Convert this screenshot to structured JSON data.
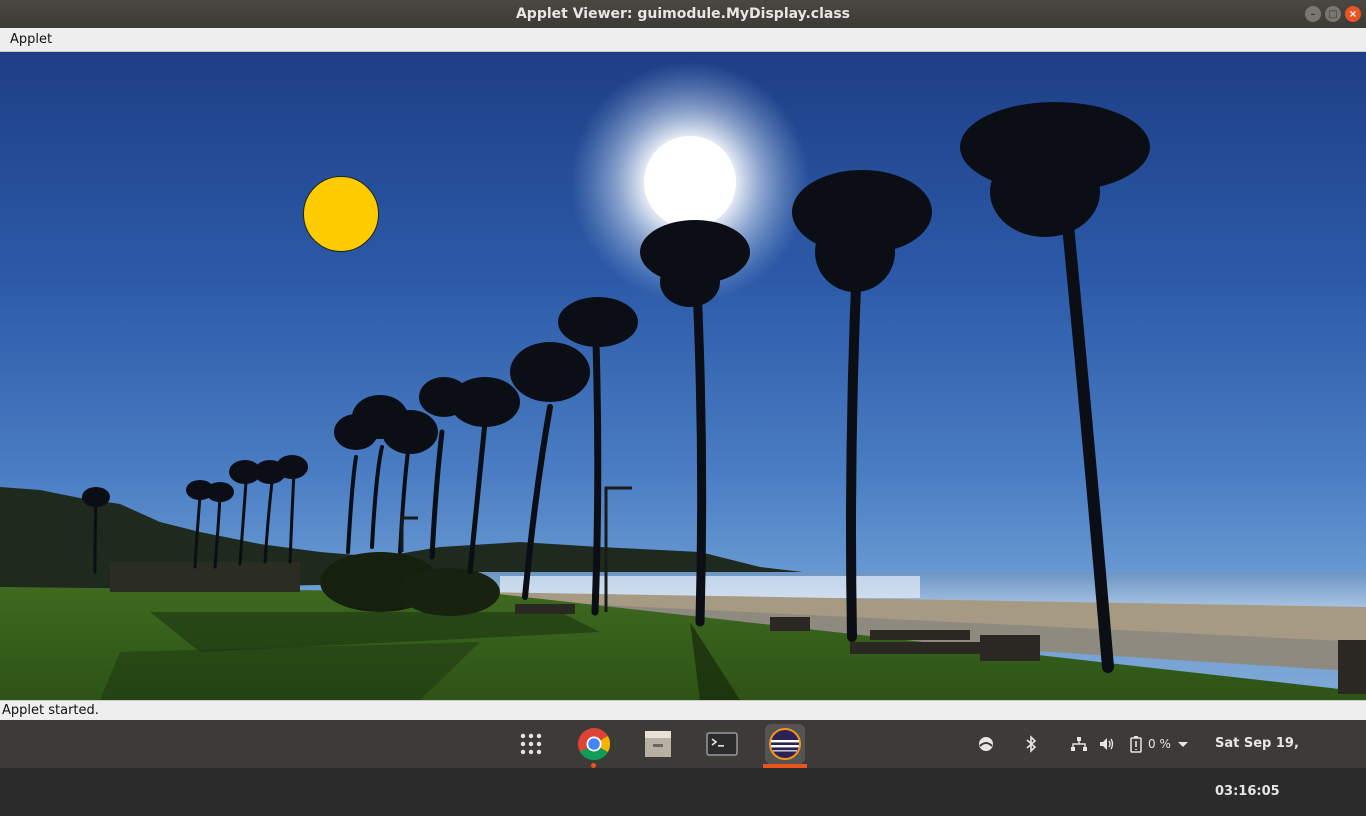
{
  "window": {
    "title": "Applet Viewer: guimodule.MyDisplay.class",
    "controls": {
      "minimize": "–",
      "maximize": "□",
      "close": "×"
    }
  },
  "menubar": {
    "items": [
      {
        "label": "Applet"
      }
    ]
  },
  "applet": {
    "background_image": "beach-palm-trees-photo",
    "shape": {
      "type": "circle",
      "fill": "#ffcc00",
      "stroke": "#222222"
    }
  },
  "statusbar": {
    "text": "Applet started."
  },
  "taskbar": {
    "launchers": [
      {
        "name": "show-applications-icon"
      },
      {
        "name": "chrome-icon"
      },
      {
        "name": "files-icon"
      },
      {
        "name": "terminal-icon"
      },
      {
        "name": "eclipse-icon",
        "active": true
      }
    ],
    "tray": {
      "battery_percent": "0 %",
      "datetime": "Sat Sep 19, 03:16:05"
    },
    "accent": "#e95420"
  }
}
